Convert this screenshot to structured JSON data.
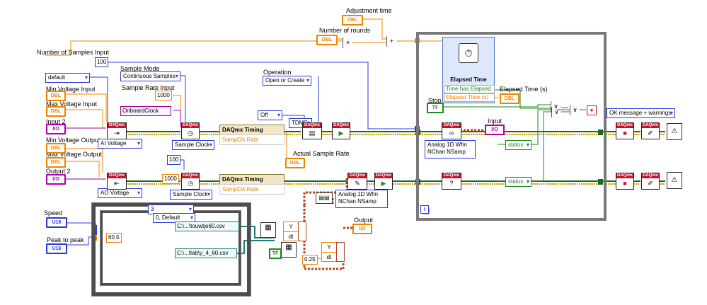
{
  "labels": {
    "adjustment_time": "Adjustment time",
    "number_of_rounds": "Number of rounds",
    "number_of_samples_input": "Number of Samples Input",
    "sample_mode": "Sample Mode",
    "sample_rate_input": "Sample Rate Input",
    "min_voltage_input": "Min Voltage Input",
    "max_voltage_input": "Max Voltage Input",
    "input2": "Input 2",
    "min_voltage_output": "Min Voltage Output",
    "max_voltage_output": "Max Voltage Output",
    "output2": "Output 2",
    "operation": "Operation",
    "actual_sample_rate": "Actual Sample Rate",
    "speed": "Speed",
    "peak_to_peak": "Peak to peak",
    "output": "Output",
    "input": "Input",
    "stop": "Stop",
    "elapsed_time_out": "Elapsed Time (s)",
    "elapsed_time_title": "Elapsed Time",
    "time_has_elapsed": "Time has Elapsed",
    "elapsed_time_s": "Elapsed Time (s)"
  },
  "terminals": {
    "dbl": "DBL",
    "u16": "U16",
    "cplx": "I/O",
    "bool": "TF"
  },
  "constants": {
    "samples_100": "100",
    "continuous_samples": "Continuous Samples",
    "rate_1000": "1000",
    "default": "default",
    "onboard_clock": "OnboardClock",
    "off": "Off",
    "open_or_create": "Open or Create",
    "tdms": "TDMS",
    "val_100b": "100",
    "val_1000b": "1000",
    "case_3": "3",
    "case_default": "0, Default",
    "file1": "C:\\...\\touwtje60.csv",
    "file2": "C:\\...tlab\\y_4_60.csv",
    "val_60_5": "60.5",
    "val_025": "0.25",
    "ok_message": "OK message + warnings",
    "y": "Y",
    "dt": "dt",
    "status": "status"
  },
  "polymorphic": {
    "ai_voltage": "AI Voltage",
    "ao_voltage": "AO Voltage",
    "sample_clock1": "Sample Clock",
    "sample_clock2": "Sample Clock",
    "analog_wfm1_line1": "Analog 1D Wfm",
    "analog_wfm1_line2": "NChan NSamp",
    "analog_wfm2_line1": "Analog 1D Wfm",
    "analog_wfm2_line2": "NChan NSamp"
  },
  "nodes": {
    "timing1": "DAQmx Timing",
    "timing1_prop": "SampClk.Rate",
    "timing2": "DAQmx Timing",
    "timing2_prop": "SampClk.Rate"
  },
  "vi": {
    "daqmx": "DAQmx"
  },
  "loop": {
    "iteration": "i"
  },
  "colors": {
    "dbl_wire": "#f08400",
    "int_wire": "#2b3bd6",
    "task_wire": "#1d6a1d",
    "error_wire": "#c8a000",
    "cluster_wire": "#b6451d",
    "bool_wire": "#1a8a1a",
    "path_wire": "#1d7f80",
    "cplx_wire": "#a000a0"
  }
}
